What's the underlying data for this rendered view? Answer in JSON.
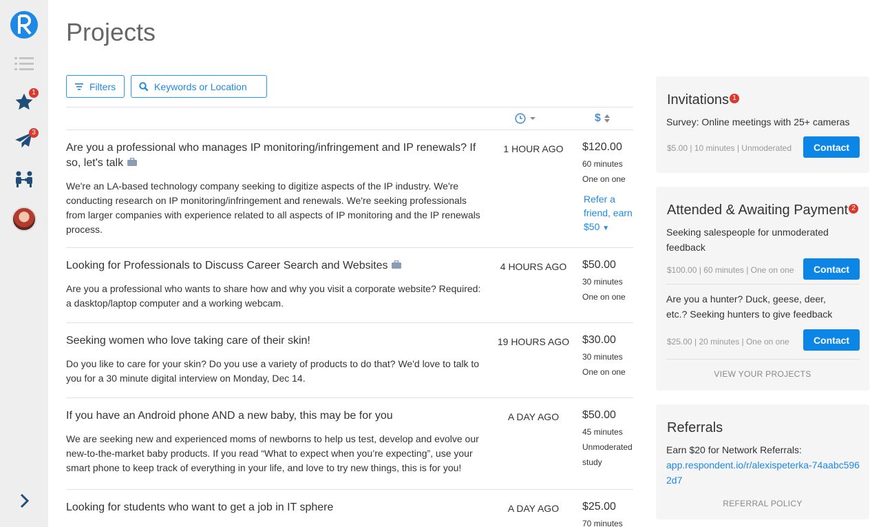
{
  "sidebar": {
    "logo_icon": "respondent-logo-icon",
    "items": [
      {
        "name": "list-icon"
      },
      {
        "name": "star-icon",
        "badge": "1"
      },
      {
        "name": "paper-plane-icon",
        "badge": "3"
      },
      {
        "name": "people-icon"
      },
      {
        "name": "avatar"
      }
    ],
    "expand_icon": "chevron-right-icon"
  },
  "page": {
    "title": "Projects",
    "filters_label": "Filters",
    "search_placeholder": "Keywords or Location"
  },
  "colors": {
    "accent": "#1e88e5",
    "badge": "#d9392f",
    "button": "#0c86e6"
  },
  "projects": [
    {
      "title": "Are you a professional who manages IP monitoring/infringement and IP renewals? If so, let's talk",
      "description": "We're an LA-based technology company seeking to digitize aspects of the IP industry. We're conducting research on IP monitoring/infringement and renewals. We're seeking professionals from larger companies with experience related to all aspects of IP monitoring and the IP renewals process.",
      "time": "1 HOUR AGO",
      "price": "$120.00",
      "duration": "60 minutes",
      "type": "One on one",
      "refer": "Refer a friend, earn $50"
    },
    {
      "title": "Looking for Professionals to Discuss Career Search and Websites",
      "description": "Are you a professional who wants to share how and why you visit a corporate website? Required: a dasktop/laptop computer and a working webcam.",
      "time": "4 HOURS AGO",
      "price": "$50.00",
      "duration": "30 minutes",
      "type": "One on one"
    },
    {
      "title": "Seeking women who love taking care of their skin!",
      "description": "Do you like to care for your skin? Do you use a variety of products to do that? We'd love to talk to you for a 30 minute digital interview on Monday, Dec 14.",
      "time": "19 HOURS AGO",
      "price": "$30.00",
      "duration": "30 minutes",
      "type": "One on one"
    },
    {
      "title": "If you have an Android phone AND a new baby, this may be for you",
      "description": "We are seeking new and experienced moms of newborns to help us test, develop and evolve our new-to-the-market baby products. If you read “What to expect when you’re expecting”, use your smart phone to keep track of everything in your life, and love to try new things, this is for you!",
      "time": "A DAY AGO",
      "price": "$50.00",
      "duration": "45 minutes",
      "type": "Unmoderated study"
    },
    {
      "title": "Looking for students who want to get a job in IT sphere",
      "time": "A DAY AGO",
      "price": "$25.00",
      "duration": "70 minutes"
    }
  ],
  "invitations": {
    "title": "Invitations",
    "badge": "1",
    "item_title": "Survey: Online meetings with 25+ cameras",
    "item_meta": "$5.00 | 10 minutes | Unmoderated",
    "contact": "Contact"
  },
  "awaiting": {
    "title": "Attended & Awaiting Payment",
    "badge": "2",
    "items": [
      {
        "title": "Seeking salespeople for unmoderated feedback",
        "meta": "$100.00 | 60 minutes | One on one",
        "contact": "Contact"
      },
      {
        "title": "Are you a hunter? Duck, geese, deer, etc.? Seeking hunters to give feedback",
        "meta": "$25.00 | 20 minutes | One on one",
        "contact": "Contact"
      }
    ],
    "view_link": "VIEW YOUR PROJECTS"
  },
  "referrals": {
    "title": "Referrals",
    "text": "Earn $20 for Network Referrals:",
    "link": "app.respondent.io/r/alexispeterka-74aabc5962d7",
    "policy": "REFERRAL POLICY"
  }
}
